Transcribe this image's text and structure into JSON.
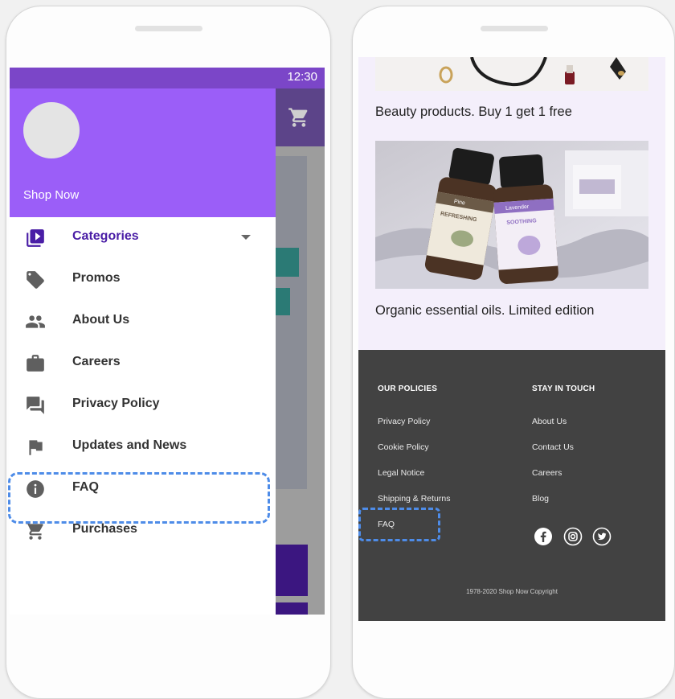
{
  "status_bar": {
    "time": "12:30"
  },
  "drawer": {
    "brand": "Shop Now",
    "items": [
      {
        "label": "Categories",
        "icon": "categories-icon",
        "active": true
      },
      {
        "label": "Promos",
        "icon": "tag-icon"
      },
      {
        "label": "About Us",
        "icon": "people-icon"
      },
      {
        "label": "Careers",
        "icon": "briefcase-icon"
      },
      {
        "label": "Privacy Policy",
        "icon": "forum-icon"
      },
      {
        "label": "Updates and News",
        "icon": "flag-icon"
      },
      {
        "label": "FAQ",
        "icon": "info-icon",
        "highlighted": true
      },
      {
        "label": "Purchases",
        "icon": "cart-icon"
      }
    ]
  },
  "right_page": {
    "captions": {
      "beauty": "Beauty products. Buy 1 get 1 free",
      "oils": "Organic essential oils. Limited edition"
    },
    "bottle_labels": {
      "left_name": "Pine",
      "left_tag": "REFRESHING",
      "right_name": "Lavender",
      "right_tag": "SOOTHING"
    },
    "footer": {
      "policies_heading": "OUR POLICIES",
      "policies": [
        "Privacy Policy",
        "Cookie Policy",
        "Legal Notice",
        "Shipping & Returns",
        "FAQ"
      ],
      "contact_heading": "STAY IN TOUCH",
      "contact": [
        "About Us",
        "Contact Us",
        "Careers",
        "Blog"
      ],
      "social": [
        "facebook-icon",
        "instagram-icon",
        "twitter-icon"
      ],
      "copyright": "1978-2020 Shop Now Copyright"
    }
  },
  "colors": {
    "drawer_header": "#9b5ef8",
    "status_bar": "#7b46c8",
    "active_label": "#4a1ea6",
    "highlight_dash": "#4e8ce8",
    "footer_bg": "#424242",
    "page_bg": "#f4effb"
  }
}
